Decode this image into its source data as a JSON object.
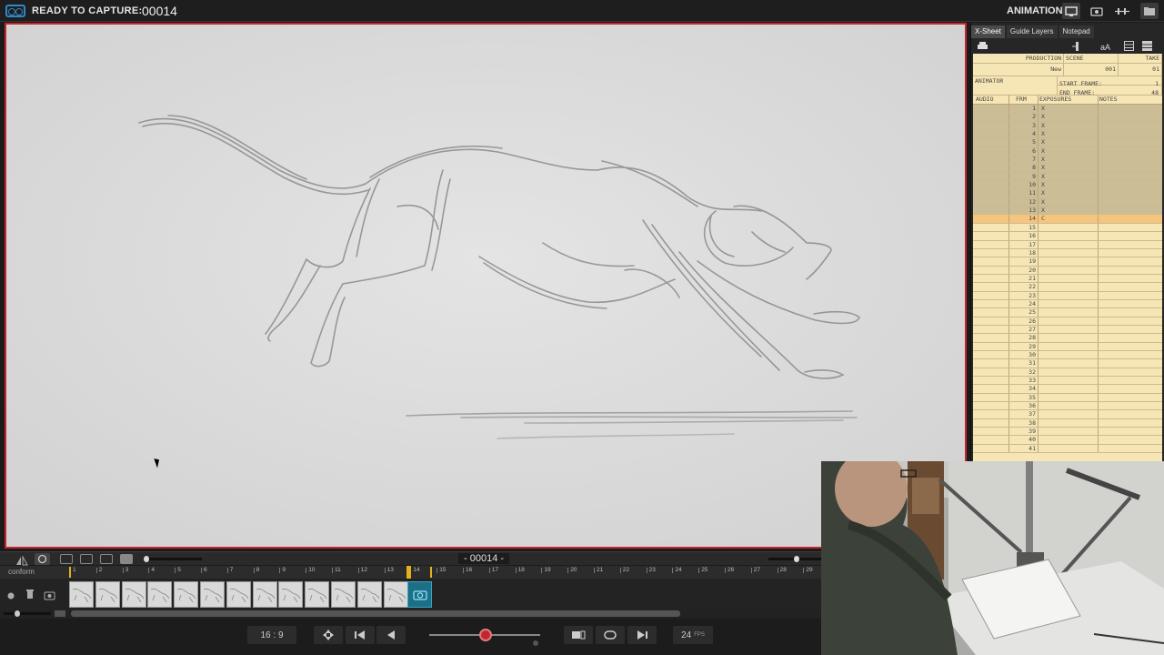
{
  "topbar": {
    "status_label": "READY TO CAPTURE:",
    "frame_counter": "00014",
    "mode_label": "ANIMATION",
    "icons": [
      "monitor-icon",
      "camera-icon",
      "levels-icon",
      "folder-icon"
    ]
  },
  "xsheet": {
    "tabs": [
      "X-Sheet",
      "Guide Layers",
      "Notepad"
    ],
    "header": {
      "production_label": "PRODUCTION",
      "scene_label": "SCENE",
      "take_label": "TAKE",
      "production_value": "New",
      "scene_value": "001",
      "take_value": "01",
      "animator_label": "ANIMATOR",
      "start_frame_label": "START FRAME:",
      "start_frame_value": "1",
      "end_frame_label": "END FRAME:",
      "end_frame_value": "48"
    },
    "columns": {
      "audio": "AUDIO",
      "frm": "FRM",
      "exposures": "EXPOSURES",
      "notes": "NOTES"
    },
    "rows": [
      {
        "frm": "1",
        "exp": "X"
      },
      {
        "frm": "2",
        "exp": "X"
      },
      {
        "frm": "3",
        "exp": "X"
      },
      {
        "frm": "4",
        "exp": "X"
      },
      {
        "frm": "5",
        "exp": "X"
      },
      {
        "frm": "6",
        "exp": "X"
      },
      {
        "frm": "7",
        "exp": "X"
      },
      {
        "frm": "8",
        "exp": "X"
      },
      {
        "frm": "9",
        "exp": "X"
      },
      {
        "frm": "10",
        "exp": "X"
      },
      {
        "frm": "11",
        "exp": "X"
      },
      {
        "frm": "12",
        "exp": "X"
      },
      {
        "frm": "13",
        "exp": "X"
      },
      {
        "frm": "14",
        "exp": "C"
      },
      {
        "frm": "15",
        "exp": ""
      },
      {
        "frm": "16",
        "exp": ""
      },
      {
        "frm": "17",
        "exp": ""
      },
      {
        "frm": "18",
        "exp": ""
      },
      {
        "frm": "19",
        "exp": ""
      },
      {
        "frm": "20",
        "exp": ""
      },
      {
        "frm": "21",
        "exp": ""
      },
      {
        "frm": "22",
        "exp": ""
      },
      {
        "frm": "23",
        "exp": ""
      },
      {
        "frm": "24",
        "exp": ""
      },
      {
        "frm": "25",
        "exp": ""
      },
      {
        "frm": "26",
        "exp": ""
      },
      {
        "frm": "27",
        "exp": ""
      },
      {
        "frm": "28",
        "exp": ""
      },
      {
        "frm": "29",
        "exp": ""
      },
      {
        "frm": "30",
        "exp": ""
      },
      {
        "frm": "31",
        "exp": ""
      },
      {
        "frm": "32",
        "exp": ""
      },
      {
        "frm": "33",
        "exp": ""
      },
      {
        "frm": "34",
        "exp": ""
      },
      {
        "frm": "35",
        "exp": ""
      },
      {
        "frm": "36",
        "exp": ""
      },
      {
        "frm": "37",
        "exp": ""
      },
      {
        "frm": "38",
        "exp": ""
      },
      {
        "frm": "39",
        "exp": ""
      },
      {
        "frm": "40",
        "exp": ""
      },
      {
        "frm": "41",
        "exp": ""
      }
    ]
  },
  "timeline": {
    "current_frame": "- 00014 -",
    "layer_label": "conform",
    "frame_numbers": [
      "1",
      "2",
      "3",
      "4",
      "5",
      "6",
      "7",
      "8",
      "9",
      "10",
      "11",
      "12",
      "13",
      "14",
      "15",
      "16",
      "17",
      "18",
      "19",
      "20",
      "21",
      "22",
      "23",
      "24",
      "25",
      "26",
      "27",
      "28",
      "29"
    ],
    "captured_frames": 13
  },
  "controls": {
    "aspect": "16 : 9",
    "fps_value": "24",
    "fps_unit": "FPS"
  },
  "colors": {
    "accent_red": "#c1272d",
    "playhead_yellow": "#e3b21a",
    "capture_blue": "#1d6f86",
    "sheet_paper": "#f7e6b5",
    "sheet_current": "#f5c57e"
  }
}
